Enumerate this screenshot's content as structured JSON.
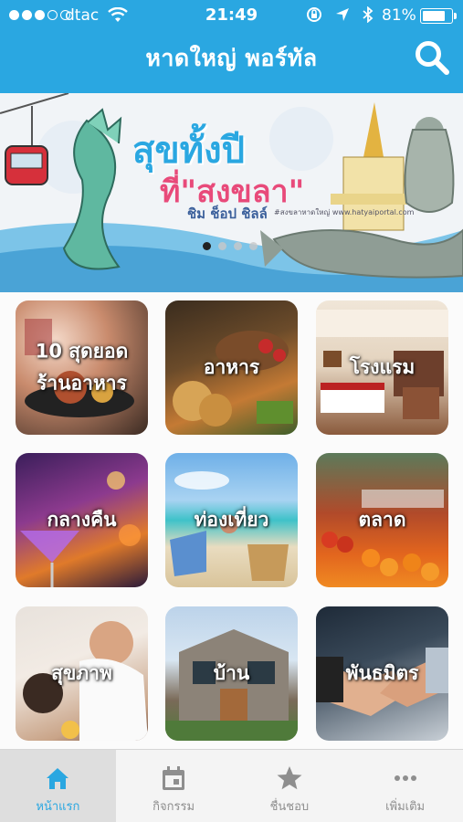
{
  "status_bar": {
    "carrier": "dtac",
    "time": "21:49",
    "battery": "81%",
    "battery_level": 0.81,
    "signal_bars": 3
  },
  "nav": {
    "title": "หาดใหญ่ พอร์ทัล",
    "search_icon": "search-icon"
  },
  "banner": {
    "title": "สุขทั้งปี",
    "subtitle": "ที่\"สงขลา\"",
    "tagline": "ชิม ช็อป ชิลล์",
    "hashtag": "#สงขลาหาดใหญ่ www.hatyaiportal.com",
    "page_count": 4,
    "active_page": 0
  },
  "categories": [
    {
      "label": "10 สุดยอด ร้านอาหาร"
    },
    {
      "label": "อาหาร"
    },
    {
      "label": "โรงแรม"
    },
    {
      "label": "กลางคืน"
    },
    {
      "label": "ท่องเที่ยว"
    },
    {
      "label": "ตลาด"
    },
    {
      "label": "สุขภาพ"
    },
    {
      "label": "บ้าน"
    },
    {
      "label": "พันธมิตร"
    }
  ],
  "tabbar": {
    "items": [
      {
        "label": "หน้าแรก",
        "icon": "home-icon",
        "active": true
      },
      {
        "label": "กิจกรรม",
        "icon": "calendar-icon",
        "active": false
      },
      {
        "label": "ชื่นชอบ",
        "icon": "star-icon",
        "active": false
      },
      {
        "label": "เพิ่มเติม",
        "icon": "more-icon",
        "active": false
      }
    ]
  },
  "colors": {
    "primary": "#2aa7e1",
    "tab_inactive": "#8e8e8e",
    "banner_pink": "#e84a7a"
  }
}
